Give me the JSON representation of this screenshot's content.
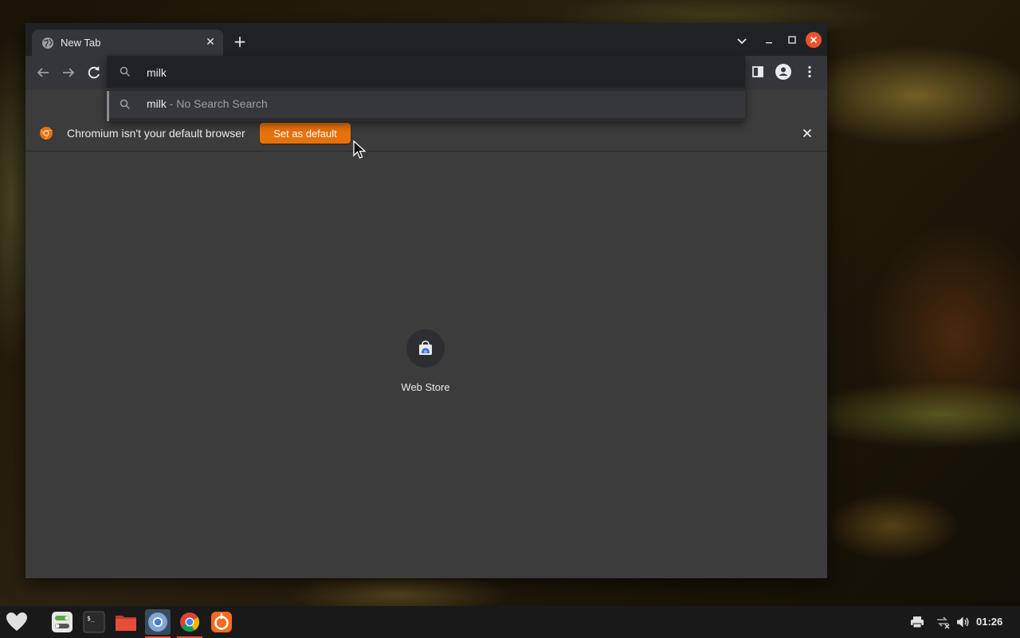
{
  "tab": {
    "title": "New Tab"
  },
  "omnibox": {
    "value": "milk",
    "suggestion": {
      "query": "milk",
      "separator": " - ",
      "label": "No Search Search"
    }
  },
  "infobar": {
    "brand": "Chromium",
    "message": " isn't your default browser",
    "button": "Set as default"
  },
  "shortcuts": [
    {
      "label": "Web Store"
    }
  ],
  "taskbar": {
    "time": "01:26"
  },
  "colors": {
    "accent": "#e8710a",
    "close": "#e9542c"
  }
}
